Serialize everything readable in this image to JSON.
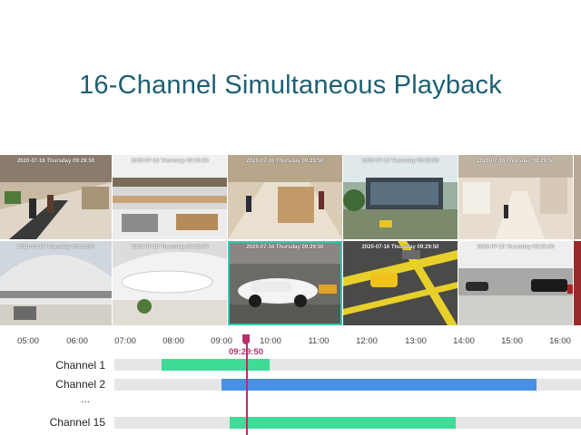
{
  "headline": "16-Channel Simultaneous Playback",
  "tiles": [
    {
      "timestamp": "2020-07-16 Thursday 09:29:50",
      "selected": false
    },
    {
      "timestamp": "2020-07-16 Thursday 09:29:50",
      "selected": false
    },
    {
      "timestamp": "2020-07-16 Thursday 09:29:50",
      "selected": false
    },
    {
      "timestamp": "2020-07-16 Thursday 09:29:50",
      "selected": false
    },
    {
      "timestamp": "2020-07-16 Thursday 09:29:50",
      "selected": false
    },
    {
      "timestamp": "2020-07-16 Thursday 09:29:50",
      "selected": false
    },
    {
      "timestamp": "2020-07-16 Thursday 09:29:50",
      "selected": false
    },
    {
      "timestamp": "2020-07-16 Thursday 09:29:50",
      "selected": false
    },
    {
      "timestamp": "2020-07-16 Thursday 09:29:50",
      "selected": true
    },
    {
      "timestamp": "2020-07-16 Thursday 09:29:50",
      "selected": false
    },
    {
      "timestamp": "2020-07-16 Thursday 09:29:50",
      "selected": false
    },
    {
      "timestamp": "",
      "selected": false
    }
  ],
  "timeline": {
    "ticks": [
      "05:00",
      "06:00",
      "07:00",
      "08:00",
      "09:00",
      "10:00",
      "11:00",
      "12:00",
      "13:00",
      "14:00",
      "15:00",
      "16:00"
    ],
    "cursor_time": "09:29:50",
    "ellipsis": "...",
    "channels": [
      {
        "label": "Channel 1",
        "start": "07:45",
        "end": "10:00",
        "color": "#3ddc97"
      },
      {
        "label": "Channel 2",
        "start": "09:00",
        "end": "15:30",
        "color": "#4a90e2"
      },
      {
        "label": "Channel 15",
        "start": "09:10",
        "end": "13:50",
        "color": "#3ddc97"
      }
    ]
  },
  "colors": {
    "headline": "#1e5f73",
    "selected_border": "#2fc9b4",
    "cursor": "#b5306a",
    "track": "#e6e6e6"
  }
}
